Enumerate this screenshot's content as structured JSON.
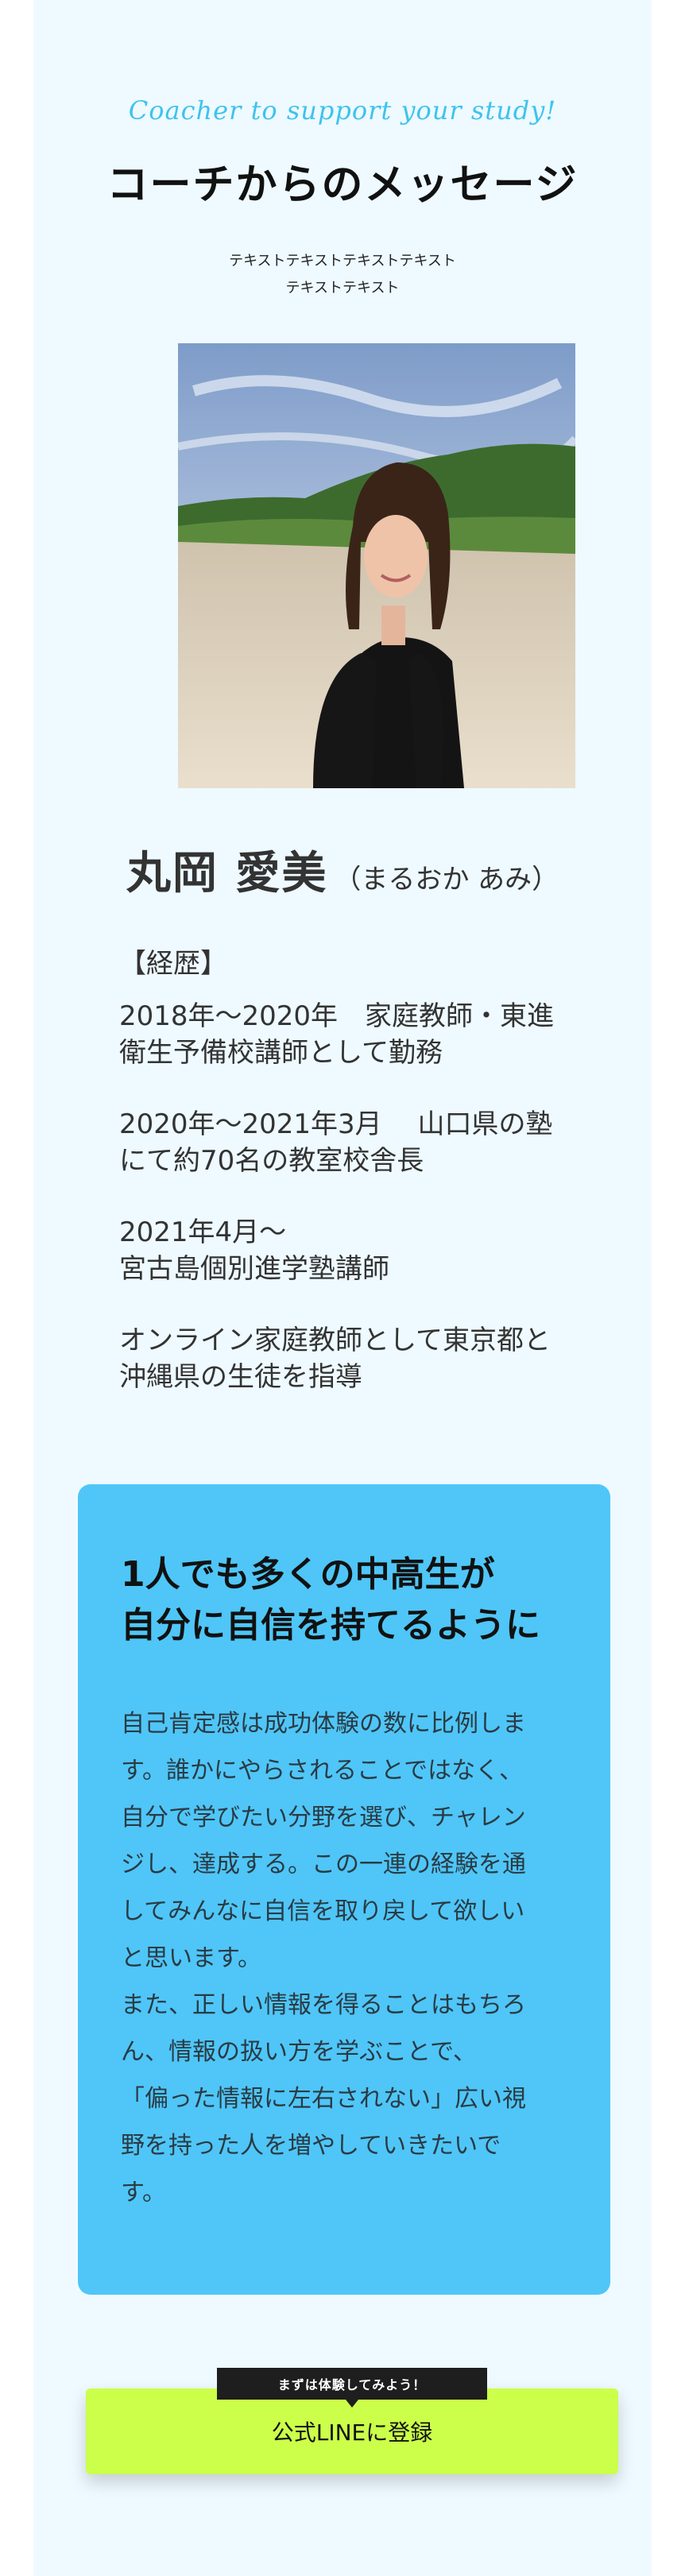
{
  "header": {
    "tagline": "Coacher to support your study!",
    "title": "コーチからのメッセージ",
    "subtext_line1": "テキストテキストテキストテキスト",
    "subtext_line2": "テキストテキスト"
  },
  "profile": {
    "name": "丸岡 愛美",
    "reading": "（まるおか あみ）"
  },
  "career": {
    "heading": "【経歴】",
    "entries": [
      [
        "2018年〜2020年　家庭教師・東進",
        "衛生予備校講師として勤務"
      ],
      [
        "2020年〜2021年3月　 山口県の塾",
        "にて約70名の教室校舎長"
      ],
      [
        "2021年4月〜",
        "宮古島個別進学塾講師"
      ],
      [
        "オンライン家庭教師として東京都と",
        "沖縄県の生徒を指導"
      ]
    ]
  },
  "message_box": {
    "heading_line1": "1人でも多くの中高生が",
    "heading_line2": "自分に自信を持てるように",
    "body_lines": [
      "自己肯定感は成功体験の数に比例しま",
      "す。誰かにやらされることではなく、",
      "自分で学びたい分野を選び、チャレン",
      "ジし、達成する。この一連の経験を通",
      "してみんなに自信を取り戻して欲しい",
      "と思います。",
      "また、正しい情報を得ることはもちろ",
      "ん、情報の扱い方を学ぶことで、",
      "「偏った情報に左右されない」広い視",
      "野を持った人を増やしていきたいで",
      "す。"
    ]
  },
  "cta": {
    "badge": "まずは体験してみよう！",
    "button_label": "公式LINEに登録"
  },
  "colors": {
    "panel_bg": "#eefaff",
    "accent_blue": "#4fc6f7",
    "tagline_blue": "#3ec3ee",
    "cta_green": "#cbff4a"
  }
}
